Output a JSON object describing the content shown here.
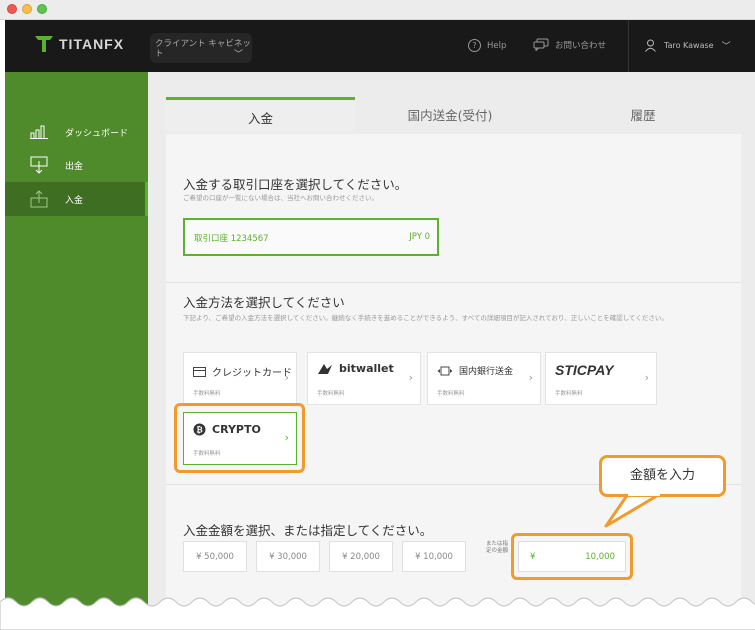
{
  "app": {
    "logo_text": "TITANFX",
    "client_select": "クライアント キャビネット",
    "help": "Help",
    "contact": "お問い合わせ",
    "user_name": "Taro Kawase"
  },
  "sidebar": {
    "items": [
      {
        "label": "ダッシュボード",
        "icon": "bar-chart-icon",
        "active": false
      },
      {
        "label": "出金",
        "icon": "withdraw-icon",
        "active": false
      },
      {
        "label": "入金",
        "icon": "deposit-icon",
        "active": true
      }
    ]
  },
  "tabs": [
    {
      "label": "入金",
      "active": true
    },
    {
      "label": "国内送金(受付)",
      "active": false
    },
    {
      "label": "履歴",
      "active": false
    }
  ],
  "account_section": {
    "title": "入金する取引口座を選択してください。",
    "subtitle": "ご希望の口座が一覧にない場合は、当社へお問い合わせください。",
    "account_label": "取引口座 1234567",
    "account_currency": "JPY 0"
  },
  "method_section": {
    "title": "入金方法を選択してください",
    "subtitle": "下記より、ご希望の入金方法を選択してください。継続なく手続きを進めることができるよう、すべての詳細項目が記入されており、正しいことを確認してください。",
    "methods": [
      {
        "name": "クレジットカード",
        "fee": "手数料無料",
        "icon": "credit-card-icon"
      },
      {
        "name": "bitwallet",
        "fee": "手数料無料",
        "icon": "bitwallet-icon"
      },
      {
        "name": "国内銀行送金",
        "fee": "手数料無料",
        "icon": "bank-transfer-icon"
      },
      {
        "name": "STICPAY",
        "fee": "手数料無料",
        "icon": "sticpay-icon"
      },
      {
        "name": "CRYPTO",
        "fee": "手数料無料",
        "icon": "bitcoin-icon"
      }
    ]
  },
  "amount_section": {
    "title": "入金金額を選択、または指定してください。",
    "presets": [
      "¥ 50,000",
      "¥ 30,000",
      "¥ 20,000",
      "¥ 10,000"
    ],
    "or_label": "または指定の金額",
    "input_currency": "¥",
    "input_value": "10,000"
  },
  "callout": {
    "text": "金額を入力"
  },
  "colors": {
    "accent": "#5cb12e",
    "highlight": "#f09b2b",
    "sidebar": "#4f8a2b",
    "topbar": "#191919"
  }
}
